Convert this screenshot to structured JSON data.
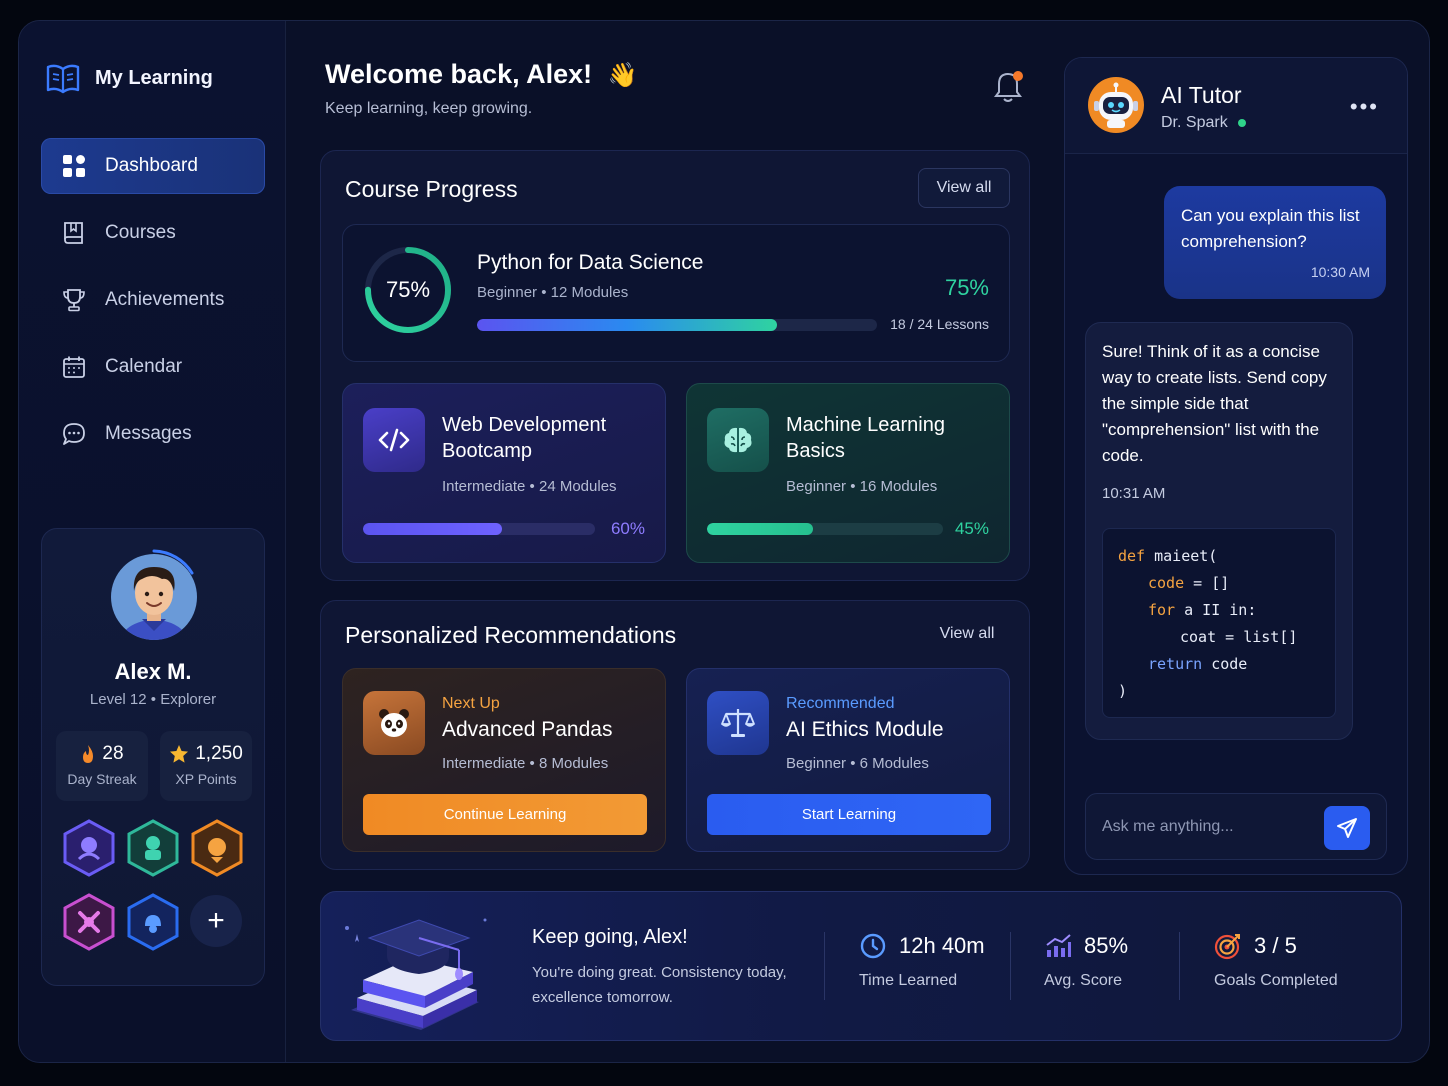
{
  "brand": {
    "name": "My Learning",
    "icon": "open-book-icon"
  },
  "sidebar": {
    "items": [
      {
        "label": "Dashboard",
        "icon": "grid-icon",
        "active": true
      },
      {
        "label": "Courses",
        "icon": "book-icon",
        "active": false
      },
      {
        "label": "Achievements",
        "icon": "trophy-icon",
        "active": false
      },
      {
        "label": "Calendar",
        "icon": "calendar-icon",
        "active": false
      },
      {
        "label": "Messages",
        "icon": "chat-bubble-icon",
        "active": false
      }
    ]
  },
  "profile": {
    "name": "Alex M.",
    "level": "Level 12",
    "title": "Explorer",
    "streak": {
      "value": "28",
      "label": "Day Streak"
    },
    "xp": {
      "value": "1,250",
      "label": "XP Points"
    },
    "add_badge": "+"
  },
  "header": {
    "welcome": "Welcome back, Alex!",
    "emoji": "👋",
    "subtitle": "Keep learning, keep growing."
  },
  "course_progress": {
    "title": "Course Progress",
    "view_all": "View all",
    "main": {
      "ring_label": "75%",
      "title": "Python for Data Science",
      "level": "Beginner",
      "modules": "12 Modules",
      "percent_label": "75%",
      "progress": 0.75,
      "lessons": "18 / 24 Lessons"
    },
    "cards": [
      {
        "title": "Web Development Bootcamp",
        "level": "Intermediate",
        "modules": "24 Modules",
        "percent_label": "60%",
        "progress": 0.6,
        "icon": "code-icon"
      },
      {
        "title": "Machine Learning Basics",
        "level": "Beginner",
        "modules": "16 Modules",
        "percent_label": "45%",
        "progress": 0.45,
        "icon": "brain-icon"
      }
    ]
  },
  "recommendations": {
    "title": "Personalized Recommendations",
    "view_all": "View all",
    "cards": [
      {
        "kicker": "Next Up",
        "title": "Advanced Pandas",
        "level": "Intermediate",
        "modules": "8 Modules",
        "button": "Continue Learning",
        "icon": "panda-icon"
      },
      {
        "kicker": "Recommended",
        "title": "AI Ethics Module",
        "level": "Beginner",
        "modules": "6 Modules",
        "button": "Start Learning",
        "icon": "scales-icon"
      }
    ]
  },
  "banner": {
    "title": "Keep going, Alex!",
    "subtitle": "You're doing great. Consistency today, excellence tomorrow.",
    "stats": [
      {
        "value": "12h 40m",
        "label": "Time Learned",
        "icon": "clock-icon"
      },
      {
        "value": "85%",
        "label": "Avg. Score",
        "icon": "chart-icon"
      },
      {
        "value": "3 / 5",
        "label": "Goals Completed",
        "icon": "target-icon"
      }
    ]
  },
  "chat": {
    "title": "AI Tutor",
    "tutor_name": "Dr. Spark",
    "more": "•••",
    "user_message": {
      "text": "Can you explain this list comprehension?",
      "time": "10:30 AM"
    },
    "bot_message": {
      "text": "Sure! Think of it as a concise way to create lists. Send copy the simple side that \"comprehension\" list with the code.",
      "time": "10:31 AM"
    },
    "code": {
      "l1_kw": "def",
      "l1_rest": " maieet(",
      "l2_kw": "code",
      "l2_rest": " = []",
      "l3_kw": "for",
      "l3_rest": " a II in:",
      "l4": "coat = list[]",
      "l5_kw": "return",
      "l5_rest": " code",
      "l6": ")"
    },
    "input_placeholder": "Ask me anything..."
  },
  "colors": {
    "accent_blue": "#2a5cf0",
    "accent_green": "#2fd3a0",
    "accent_purple": "#6a5cf5",
    "accent_orange": "#f08a24"
  }
}
